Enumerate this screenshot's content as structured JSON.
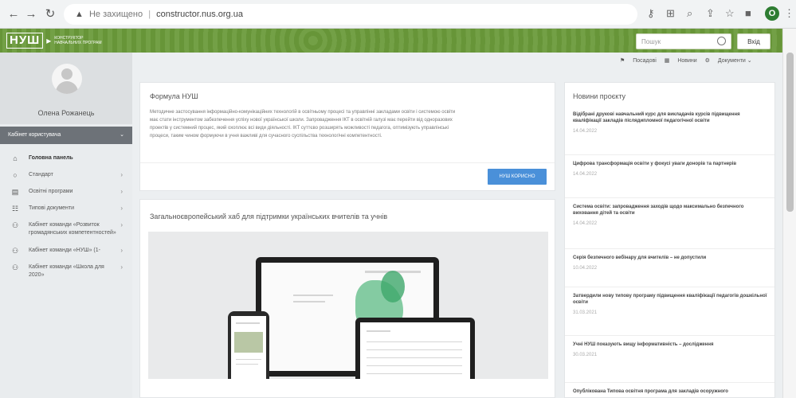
{
  "browser": {
    "security_label": "Не захищено",
    "url": "constructor.nus.org.ua",
    "profile_initial": "O"
  },
  "header": {
    "logo_main": "НУШ",
    "logo_sub": "Конструктор навчальних програм",
    "search_placeholder": "Пошук",
    "login_label": "Вхід"
  },
  "top_links": [
    "Посадові",
    "Новини",
    "Документи"
  ],
  "sidebar": {
    "user_name": "Олена Рожанець",
    "cabinet_label": "Кабінет користувача",
    "items": [
      {
        "label": "Головна панель",
        "icon": "home-icon",
        "arrow": false,
        "active": true
      },
      {
        "label": "Стандарт",
        "icon": "circle-icon",
        "arrow": true,
        "active": false
      },
      {
        "label": "Освітні програми",
        "icon": "document-icon",
        "arrow": true,
        "active": false
      },
      {
        "label": "Типові документи",
        "icon": "table-icon",
        "arrow": true,
        "active": false
      },
      {
        "label": "Кабінет команди «Розвиток громадянських компетентностей»",
        "icon": "team-icon",
        "arrow": true,
        "active": false
      },
      {
        "label": "Кабінет команди «НУШ» (1-",
        "icon": "team-icon",
        "arrow": true,
        "active": false
      },
      {
        "label": "Кабінет команди «Школа для 2020»",
        "icon": "team-icon",
        "arrow": true,
        "active": false
      }
    ]
  },
  "formula_card": {
    "title": "Формула НУШ",
    "lines": [
      "Методичне застосування інформаційно-комунікаційних технологій в освітньому процесі та управлінні закладами освіти і системою освіти",
      "має стати інструментом забезпечення успіху нової української школи. Запровадження ІКТ в освітній галузі має перейти від одноразових",
      "проектів у системний процес, який охоплює всі види діяльності. ІКТ суттєво розширять можливості педагога, оптимізують управлінські",
      "процеси, таким чином формуючи в учня важливі для сучасного суспільства технологічні компетентності."
    ],
    "button_label": "НУШ КОРИСНО"
  },
  "hub_card": {
    "title": "Загальноєвропейський хаб для підтримки українських вчителів та учнів"
  },
  "news": {
    "title": "Новини проєкту",
    "items": [
      {
        "title": "Відібрані друкові навчальний курс для викладачів курсів підвищення кваліфікації закладів післядипломної педагогічної освіти",
        "date": "14.04.2022"
      },
      {
        "title": "Цифрова трансформація освіти у фокусі уваги донорів та партнерів",
        "date": "14.04.2022"
      },
      {
        "title": "Система освіти: запровадження заходів щодо максимально безпечного виховання дітей та освіти",
        "date": "14.04.2022"
      },
      {
        "title": "Серія безпечного вебінару для вчителів – не допустили",
        "date": "10.04.2022"
      },
      {
        "title": "Затвердили нову типову програму підвищення кваліфікації педагогів дошкільної освіти",
        "date": "31.03.2021"
      },
      {
        "title": "Учні НУШ показують вищу інформативність – дослідження",
        "date": "30.03.2021"
      },
      {
        "title": "Опублікована Типова освітня програма для закладів осоружного",
        "date": ""
      }
    ]
  }
}
